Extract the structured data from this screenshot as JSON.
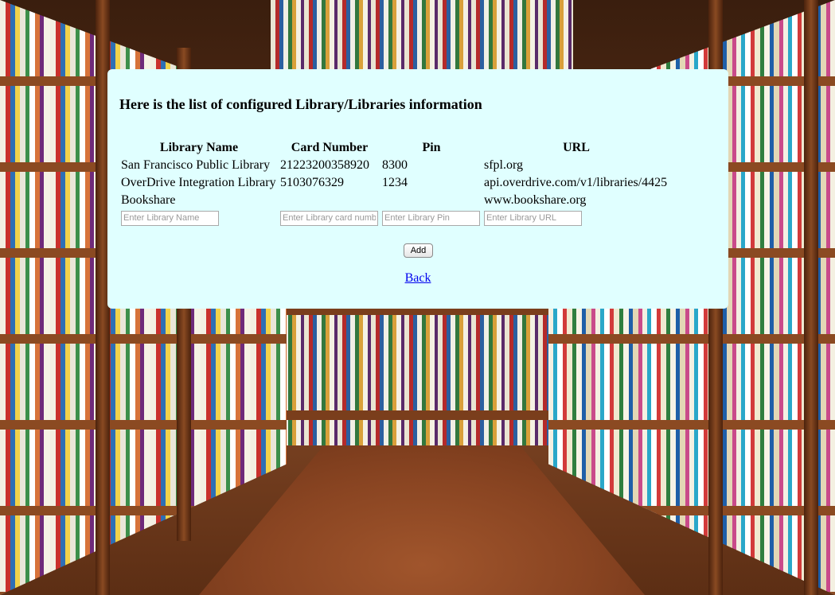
{
  "page": {
    "title": "Here is the list of configured Library/Libraries information"
  },
  "table": {
    "headers": {
      "name": "Library Name",
      "card": "Card Number",
      "pin": "Pin",
      "url": "URL"
    },
    "rows": [
      {
        "name": "San Francisco Public Library",
        "card": "21223200358920",
        "pin": "8300",
        "url": "sfpl.org"
      },
      {
        "name": "OverDrive Integration Library",
        "card": "5103076329",
        "pin": "1234",
        "url": "api.overdrive.com/v1/libraries/4425"
      },
      {
        "name": "Bookshare",
        "card": "",
        "pin": "",
        "url": "www.bookshare.org"
      }
    ],
    "inputs": {
      "name_placeholder": "Enter Library Name",
      "card_placeholder": "Enter Library card number",
      "pin_placeholder": "Enter Library Pin",
      "url_placeholder": "Enter Library URL",
      "name_value": "",
      "card_value": "",
      "pin_value": "",
      "url_value": ""
    }
  },
  "actions": {
    "add_label": "Add",
    "back_label": "Back"
  },
  "colors": {
    "panel_background": "#e0ffff",
    "link": "#0000ee"
  }
}
